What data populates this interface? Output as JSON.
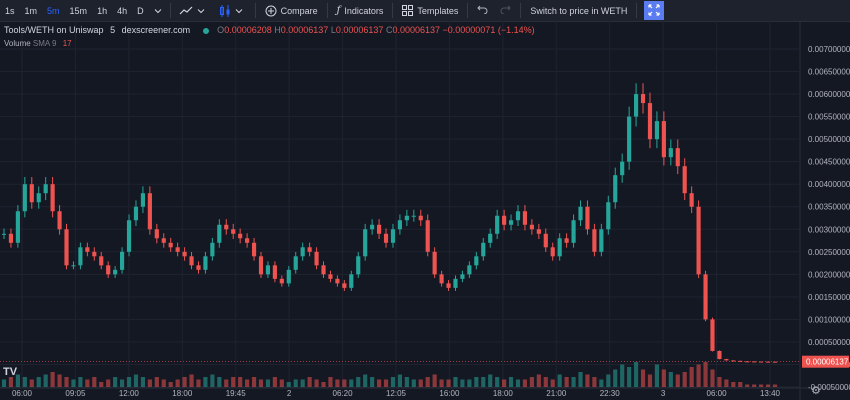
{
  "toolbar": {
    "intervals": [
      "1s",
      "1m",
      "5m",
      "15m",
      "1h",
      "4h",
      "D"
    ],
    "active_interval": "5m",
    "compare_label": "Compare",
    "indicators_label": "Indicators",
    "templates_label": "Templates",
    "switch_label": "Switch to price in WETH",
    "icons": [
      "line-chart-type-icon",
      "chevron-down-icon",
      "candles-icon",
      "plus-circle-icon",
      "fx-icon",
      "templates-grid-icon",
      "undo-icon",
      "redo-icon",
      "fullscreen-icon"
    ]
  },
  "legend": {
    "pair": "Tools/WETH on Uniswap",
    "interval": "5",
    "source": "dexscreener.com",
    "o_key": "O",
    "o_val": "0.00006208",
    "h_key": "H",
    "h_val": "0.00006137",
    "l_key": "L",
    "l_val": "0.00006137",
    "c_key": "C",
    "c_val": "0.00006137",
    "change": "−0.00000071 (−1.14%)"
  },
  "volume": {
    "label": "Volume",
    "sma": "SMA 9",
    "value": "17"
  },
  "logo": "TV",
  "colors": {
    "up": "#26a69a",
    "down": "#ef5350",
    "background": "#141823",
    "grid": "#1f2330",
    "last_price_bg": "#ef5350"
  },
  "chart_data": {
    "type": "candlestick",
    "y_ticks": [
      "0.00700000",
      "0.00650000",
      "0.00600000",
      "0.00550000",
      "0.00500000",
      "0.00450000",
      "0.00400000",
      "0.00350000",
      "0.00300000",
      "0.00250000",
      "0.00200000",
      "0.00150000",
      "0.00100000",
      "0.00050000",
      "0.00000000",
      "-0.00050000"
    ],
    "ylim": [
      -0.0005,
      0.0072
    ],
    "x_ticks": [
      "06:00",
      "09:05",
      "12:00",
      "18:00",
      "19:45",
      "2",
      "06:20",
      "12:05",
      "16:00",
      "18:00",
      "21:00",
      "22:30",
      "3",
      "06:00",
      "13:40"
    ],
    "last_price": "0.00006137",
    "series": [
      {
        "name": "price",
        "close": [
          0.0029,
          0.0027,
          0.0034,
          0.004,
          0.0036,
          0.0038,
          0.004,
          0.0034,
          0.003,
          0.0022,
          0.0022,
          0.0026,
          0.0025,
          0.0024,
          0.0022,
          0.002,
          0.0021,
          0.0025,
          0.0032,
          0.0035,
          0.0038,
          0.003,
          0.0028,
          0.0027,
          0.0026,
          0.0025,
          0.0024,
          0.0022,
          0.0021,
          0.0024,
          0.0027,
          0.0031,
          0.003,
          0.0029,
          0.0028,
          0.0027,
          0.0024,
          0.002,
          0.0022,
          0.0019,
          0.0018,
          0.0021,
          0.0024,
          0.0026,
          0.0025,
          0.0022,
          0.002,
          0.0019,
          0.0018,
          0.0017,
          0.002,
          0.0024,
          0.003,
          0.0031,
          0.0029,
          0.0027,
          0.003,
          0.0032,
          0.0033,
          0.0033,
          0.0032,
          0.0025,
          0.002,
          0.0018,
          0.0017,
          0.0019,
          0.002,
          0.0022,
          0.0024,
          0.0027,
          0.0029,
          0.0033,
          0.0031,
          0.0032,
          0.0034,
          0.0031,
          0.003,
          0.0029,
          0.0026,
          0.0024,
          0.0028,
          0.0027,
          0.0032,
          0.0035,
          0.003,
          0.0025,
          0.003,
          0.0036,
          0.0042,
          0.0045,
          0.0055,
          0.006,
          0.0058,
          0.005,
          0.0054,
          0.0046,
          0.0048,
          0.0044,
          0.0038,
          0.0035,
          0.002,
          0.001,
          0.0003,
          0.00012,
          9e-05,
          8e-05,
          7e-05,
          6.8e-05,
          6.5e-05,
          6.3e-05,
          6.2e-05,
          6.137e-05
        ]
      },
      {
        "name": "volume",
        "values": [
          3,
          4,
          5,
          4,
          3,
          4,
          5,
          6,
          5,
          4,
          3,
          4,
          3,
          4,
          2,
          3,
          4,
          3,
          4,
          5,
          4,
          3,
          4,
          3,
          2,
          3,
          4,
          5,
          3,
          4,
          5,
          4,
          3,
          4,
          4,
          3,
          4,
          3,
          3,
          4,
          3,
          2,
          3,
          3,
          4,
          3,
          2,
          4,
          3,
          3,
          3,
          4,
          5,
          4,
          3,
          3,
          4,
          5,
          4,
          3,
          3,
          4,
          5,
          3,
          3,
          4,
          3,
          3,
          4,
          4,
          5,
          4,
          3,
          4,
          3,
          3,
          4,
          5,
          4,
          3,
          5,
          4,
          4,
          6,
          5,
          4,
          3,
          5,
          7,
          9,
          8,
          10,
          7,
          5,
          9,
          7,
          6,
          5,
          6,
          8,
          9,
          10,
          7,
          4,
          3,
          2,
          2,
          1,
          1,
          1,
          1,
          1
        ]
      }
    ]
  }
}
